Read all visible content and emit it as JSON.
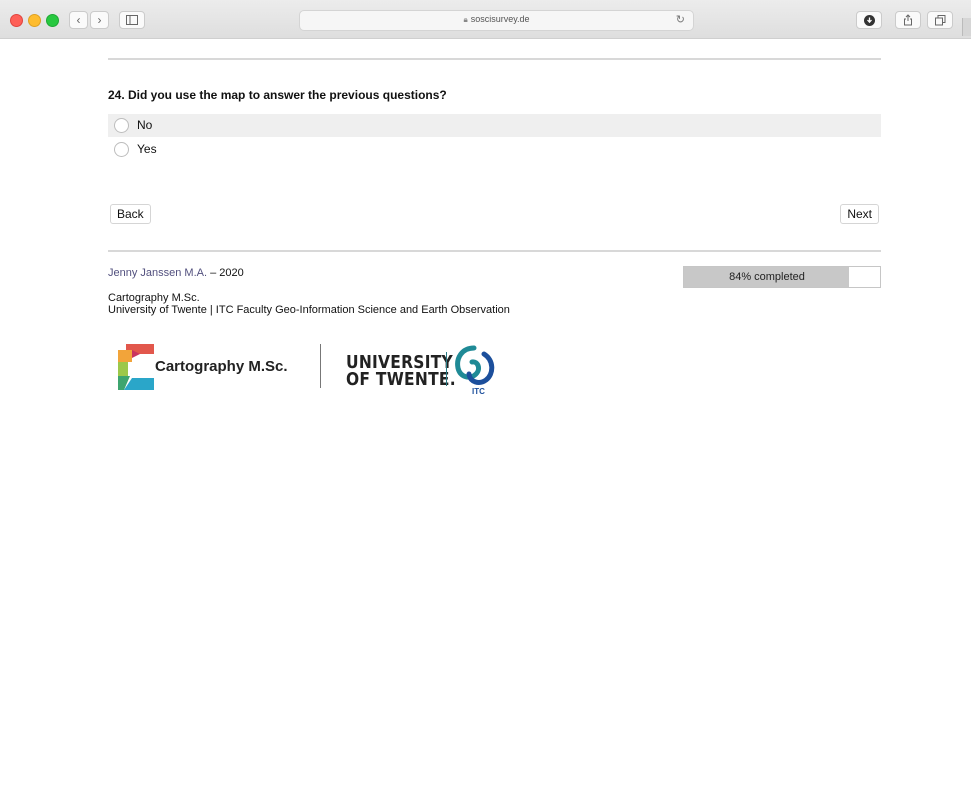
{
  "browser": {
    "url": "soscisurvey.de"
  },
  "survey": {
    "question": "24. Did you use the map to answer the previous questions?",
    "options": [
      {
        "label": "No",
        "selected": false
      },
      {
        "label": "Yes",
        "selected": false
      }
    ],
    "back_label": "Back",
    "next_label": "Next"
  },
  "footer": {
    "author_name": "Jenny Janssen M.A.",
    "author_year": " – 2020",
    "progress_text": "84% completed",
    "progress_value": 0.84,
    "program": "Cartography M.Sc.",
    "institution": "University of Twente | ITC Faculty Geo-Information Science and Earth Observation",
    "logo_cartography_text": "Cartography M.Sc.",
    "logo_ut_line1": "UNIVERSITY",
    "logo_ut_line2": "OF TWENTE.",
    "logo_itc_text": "ITC"
  },
  "colors": {
    "author_link": "#52507e",
    "progress_fill": "#c8c8c8",
    "itc_teal": "#1f8a96",
    "itc_blue": "#1c4f9c"
  }
}
